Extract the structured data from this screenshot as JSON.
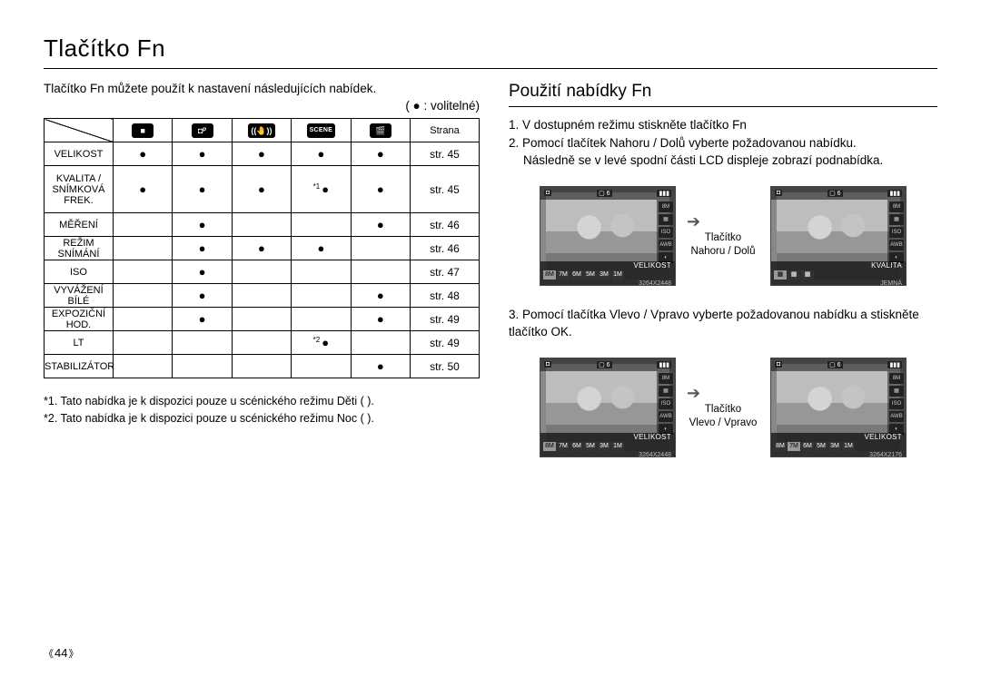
{
  "title": "Tlačítko Fn",
  "intro": "Tlačítko Fn můžete použít k nastavení následujících nabídek.",
  "legend": "( ● : volitelné)",
  "table": {
    "header_last": "Strana",
    "rows": [
      {
        "label": "VELIKOST",
        "cells": [
          "●",
          "●",
          "●",
          "●",
          "●"
        ],
        "page": "str. 45"
      },
      {
        "label": "KVALITA / SNÍMKOVÁ FREK.",
        "cells": [
          "●",
          "●",
          "●",
          "*1 ●",
          "●"
        ],
        "page": "str. 45"
      },
      {
        "label": "MĚŘENÍ",
        "cells": [
          "",
          "●",
          "",
          "",
          "●"
        ],
        "page": "str. 46"
      },
      {
        "label": "REŽIM SNÍMÁNÍ",
        "cells": [
          "",
          "●",
          "●",
          "●",
          ""
        ],
        "page": "str. 46"
      },
      {
        "label": "ISO",
        "cells": [
          "",
          "●",
          "",
          "",
          ""
        ],
        "page": "str. 47"
      },
      {
        "label": "VYVÁŽENÍ BÍLÉ",
        "cells": [
          "",
          "●",
          "",
          "",
          "●"
        ],
        "page": "str. 48"
      },
      {
        "label": "EXPOZIČNÍ HOD.",
        "cells": [
          "",
          "●",
          "",
          "",
          "●"
        ],
        "page": "str. 49"
      },
      {
        "label": "LT",
        "cells": [
          "",
          "",
          "",
          "*2 ●",
          ""
        ],
        "page": "str. 49"
      },
      {
        "label": "STABILIZÁTOR",
        "cells": [
          "",
          "",
          "",
          "",
          "●"
        ],
        "page": "str. 50"
      }
    ]
  },
  "footnotes": {
    "f1": "*1. Tato nabídka je k dispozici pouze u scénického režimu Děti (      ).",
    "f2": "*2. Tato nabídka je k dispozici pouze u scénického režimu Noc (      )."
  },
  "subhead": "Použití nabídky Fn",
  "steps": {
    "s1": "1. V dostupném režimu stiskněte tlačítko Fn",
    "s2": "2. Pomocí tlačítek Nahoru / Dolů vyberte požadovanou nabídku.",
    "s2b": "Následně se v levé spodní části LCD displeje zobrazí podnabídka.",
    "s3": "3. Pomocí tlačítka Vlevo / Vpravo vyberte požadovanou nabídku a stiskněte tlačítko OK."
  },
  "illus": {
    "arrow1_a": "Tlačítko",
    "arrow1_b": "Nahoru / Dolů",
    "arrow2_a": "Tlačítko",
    "arrow2_b": "Vlevo / Vpravo",
    "lcd1_label": "VELIKOST",
    "lcd1_sub": "3264X2448",
    "lcd2_label": "KVALITA",
    "lcd2_sub": "JEMNÁ",
    "lcd3_label": "VELIKOST",
    "lcd3_sub": "3264X2448",
    "lcd4_label": "VELIKOST",
    "lcd4_sub": "3264X2176"
  },
  "icon_scene": "SCENE",
  "pagenum": "44"
}
